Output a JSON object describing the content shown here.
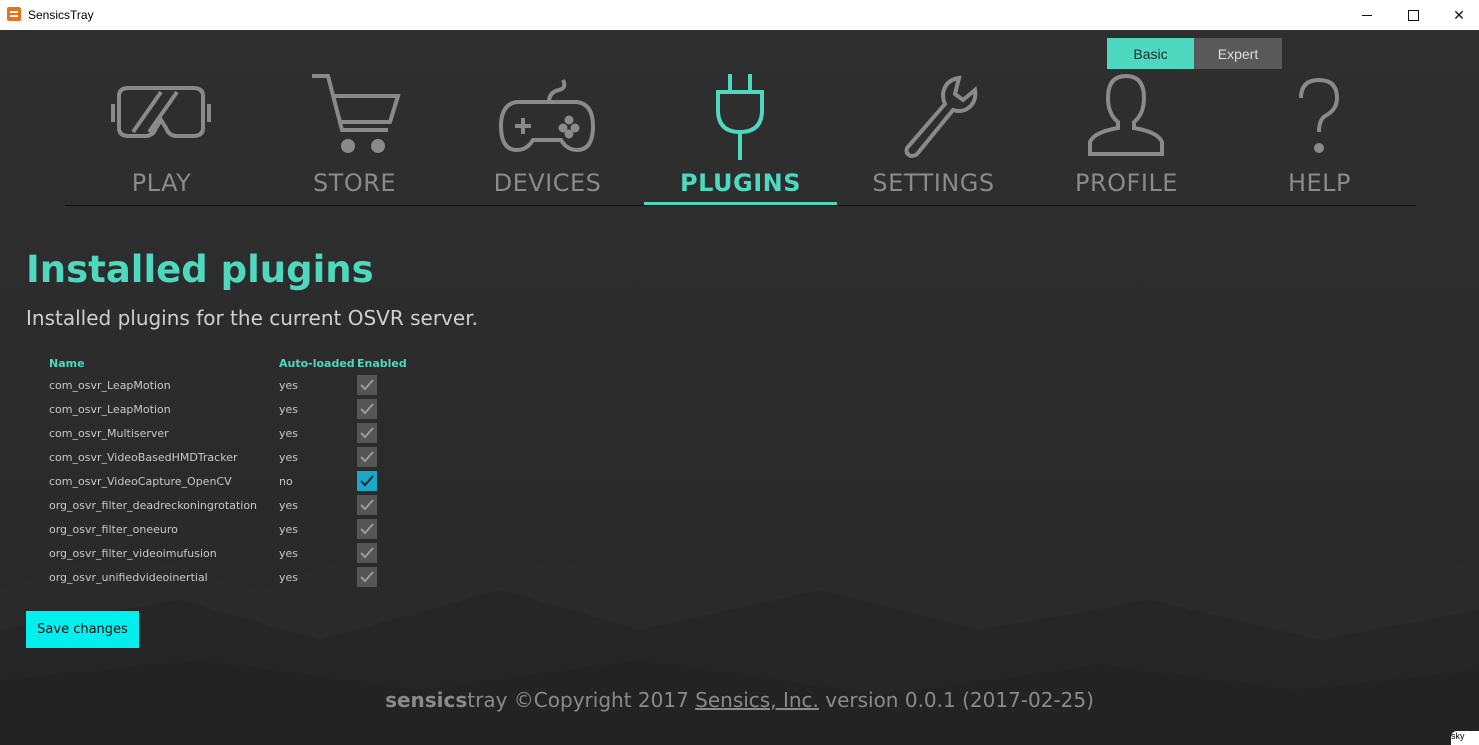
{
  "window": {
    "title": "SensicsTray"
  },
  "mode_toggle": {
    "basic": "Basic",
    "expert": "Expert"
  },
  "nav": [
    {
      "label": "PLAY",
      "icon": "vr-headset-icon"
    },
    {
      "label": "STORE",
      "icon": "cart-icon"
    },
    {
      "label": "DEVICES",
      "icon": "gamepad-icon"
    },
    {
      "label": "PLUGINS",
      "icon": "plug-icon",
      "active": true
    },
    {
      "label": "SETTINGS",
      "icon": "wrench-icon"
    },
    {
      "label": "PROFILE",
      "icon": "user-icon"
    },
    {
      "label": "HELP",
      "icon": "question-icon"
    }
  ],
  "main": {
    "title": "Installed plugins",
    "subtitle": "Installed plugins for the current OSVR server.",
    "columns": [
      "Name",
      "Auto-loaded",
      "Enabled"
    ],
    "plugins": [
      {
        "name": "com_osvr_LeapMotion",
        "auto": "yes",
        "enabled": true
      },
      {
        "name": "com_osvr_LeapMotion",
        "auto": "yes",
        "enabled": true
      },
      {
        "name": "com_osvr_Multiserver",
        "auto": "yes",
        "enabled": true
      },
      {
        "name": "com_osvr_VideoBasedHMDTracker",
        "auto": "yes",
        "enabled": true
      },
      {
        "name": "com_osvr_VideoCapture_OpenCV",
        "auto": "no",
        "enabled": true
      },
      {
        "name": "org_osvr_filter_deadreckoningrotation",
        "auto": "yes",
        "enabled": true
      },
      {
        "name": "org_osvr_filter_oneeuro",
        "auto": "yes",
        "enabled": true
      },
      {
        "name": "org_osvr_filter_videoimufusion",
        "auto": "yes",
        "enabled": true
      },
      {
        "name": "org_osvr_unifiedvideoinertial",
        "auto": "yes",
        "enabled": true
      }
    ],
    "save_label": "Save changes"
  },
  "footer": {
    "brand_bold": "sensics",
    "brand_rest": "tray",
    "copyright": " ©Copyright 2017 ",
    "company": "Sensics, Inc.",
    "version": " version 0.0.1 (2017-02-25)"
  },
  "colors": {
    "accent": "#4fd8c0",
    "save_button": "#00f0f0",
    "checkbox_on": "#1aa8c7"
  }
}
